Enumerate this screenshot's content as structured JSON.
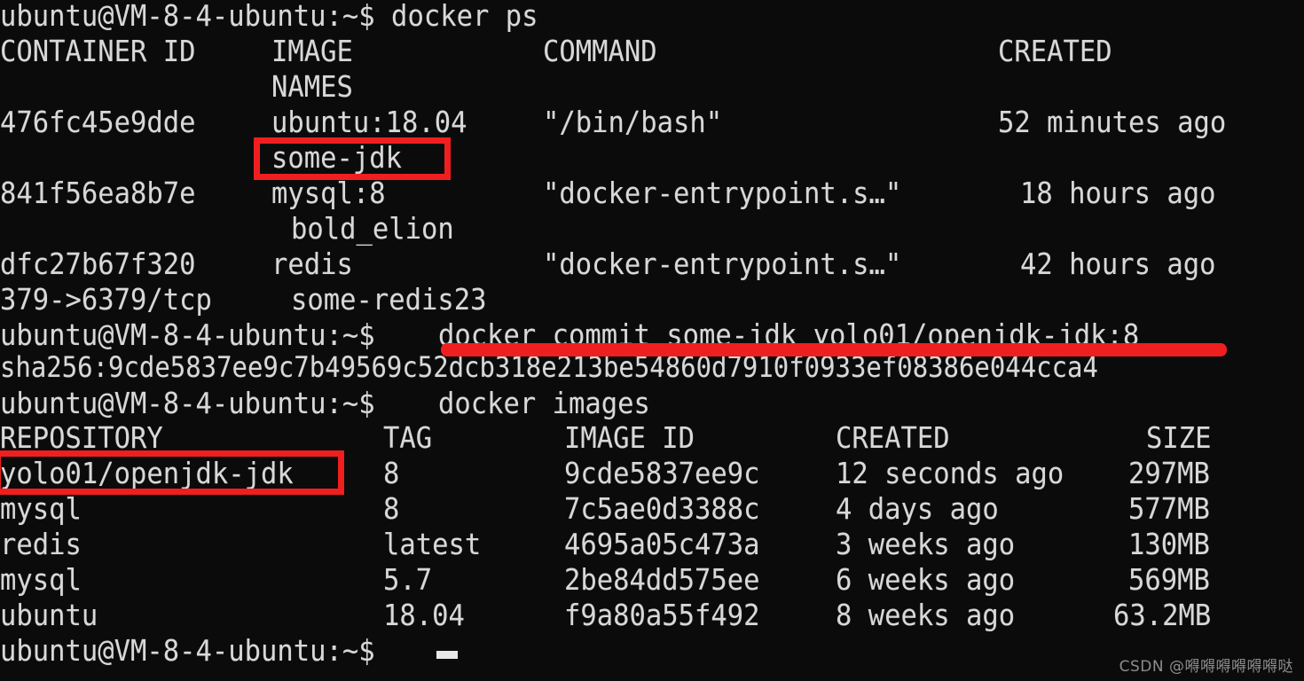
{
  "terminal": {
    "background_color": "#0b0b0b",
    "foreground_color": "#dcdcdc",
    "annotation_color": "#f01f1f",
    "prompt": "ubuntu@VM-8-4-ubuntu:~$",
    "lines": [
      "ubuntu@VM-8-4-ubuntu:~$ docker ps",
      "CONTAINER ID   IMAGE          COMMAND                  CREATED",
      "               NAMES",
      "476fc45e9dde   ubuntu:18.04   \"/bin/bash\"              52 minutes ago",
      "               some-jdk",
      "841f56ea8b7e   mysql:8        \"docker-entrypoint.s…\"   18 hours ago",
      "                bold_elion",
      "dfc27b67f320   redis          \"docker-entrypoint.s…\"   42 hours ago",
      "379->6379/tcp   some-redis23",
      "ubuntu@VM-8-4-ubuntu:~$ docker commit some-jdk yolo01/openjdk-jdk:8",
      "sha256:9cde5837ee9c7b49569c52dcb318e213be54860d7910f0933ef08386e044cca4",
      "ubuntu@VM-8-4-ubuntu:~$ docker images",
      "REPOSITORY           TAG      IMAGE ID       CREATED          SIZE",
      "yolo01/openjdk-jdk   8        9cde5837ee9c   12 seconds ago   297MB",
      "mysql                8        7c5ae0d3388c   4 days ago       577MB",
      "redis                latest   4695a05c473a   3 weeks ago      130MB",
      "mysql                5.7      2be84dd575ee   6 weeks ago      569MB",
      "ubuntu               18.04    f9a80a55f492   8 weeks ago      63.2MB",
      "ubuntu@VM-8-4-ubuntu:~$ "
    ]
  },
  "commands": {
    "docker_ps": "docker ps",
    "docker_commit": "docker commit some-jdk yolo01/openjdk-jdk:8",
    "docker_images": "docker images",
    "commit_digest": "sha256:9cde5837ee9c7b49569c52dcb318e213be54860d7910f0933ef08386e044cca4"
  },
  "ps_table": {
    "headers": [
      "CONTAINER ID",
      "IMAGE",
      "COMMAND",
      "CREATED",
      "NAMES"
    ],
    "rows": [
      {
        "container_id": "476fc45e9dde",
        "image": "ubuntu:18.04",
        "command": "\"/bin/bash\"",
        "created": "52 minutes ago",
        "ports": "",
        "names": "some-jdk"
      },
      {
        "container_id": "841f56ea8b7e",
        "image": "mysql:8",
        "command": "\"docker-entrypoint.s…\"",
        "created": "18 hours ago",
        "ports": "",
        "names": "bold_elion"
      },
      {
        "container_id": "dfc27b67f320",
        "image": "redis",
        "command": "\"docker-entrypoint.s…\"",
        "created": "42 hours ago",
        "ports": "379->6379/tcp",
        "names": "some-redis23"
      }
    ]
  },
  "images_table": {
    "headers": [
      "REPOSITORY",
      "TAG",
      "IMAGE ID",
      "CREATED",
      "SIZE"
    ],
    "rows": [
      {
        "repository": "yolo01/openjdk-jdk",
        "tag": "8",
        "image_id": "9cde5837ee9c",
        "created": "12 seconds ago",
        "size": "297MB"
      },
      {
        "repository": "mysql",
        "tag": "8",
        "image_id": "7c5ae0d3388c",
        "created": "4 days ago",
        "size": "577MB"
      },
      {
        "repository": "redis",
        "tag": "latest",
        "image_id": "4695a05c473a",
        "created": "3 weeks ago",
        "size": "130MB"
      },
      {
        "repository": "mysql",
        "tag": "5.7",
        "image_id": "2be84dd575ee",
        "created": "6 weeks ago",
        "size": "569MB"
      },
      {
        "repository": "ubuntu",
        "tag": "18.04",
        "image_id": "f9a80a55f492",
        "created": "8 weeks ago",
        "size": "63.2MB"
      }
    ]
  },
  "rendered_rows": {
    "r00": "ubuntu@VM-8-4-ubuntu:~$ docker ps",
    "r01_a": "CONTAINER ID",
    "r01_b": "IMAGE",
    "r01_c": "COMMAND",
    "r01_d": "CREATED",
    "r02_b": "NAMES",
    "r03_a": "476fc45e9dde",
    "r03_b": "ubuntu:18.04",
    "r03_c": "\"/bin/bash\"",
    "r03_d": "52 minutes ago",
    "r04_b": "some-jdk",
    "r05_a": "841f56ea8b7e",
    "r05_b": "mysql:8",
    "r05_c": "\"docker-entrypoint.s…\"",
    "r05_d": "18 hours ago",
    "r06_b": "bold_elion",
    "r07_a": "dfc27b67f320",
    "r07_b": "redis",
    "r07_c": "\"docker-entrypoint.s…\"",
    "r07_d": "42 hours ago",
    "r08_a": "379->6379/tcp",
    "r08_b": "some-redis23",
    "r09_prompt": "ubuntu@VM-8-4-ubuntu:~$",
    "r09_cmd": "docker commit some-jdk yolo01/openjdk-jdk:8",
    "r10": "sha256:9cde5837ee9c7b49569c52dcb318e213be54860d7910f0933ef08386e044cca4",
    "r11_prompt": "ubuntu@VM-8-4-ubuntu:~$",
    "r11_cmd": "docker images",
    "r12_a": "REPOSITORY",
    "r12_b": "TAG",
    "r12_c": "IMAGE ID",
    "r12_d": "CREATED",
    "r12_e": "SIZE",
    "r13_a": "yolo01/openjdk-jdk",
    "r13_b": "8",
    "r13_c": "9cde5837ee9c",
    "r13_d": "12 seconds ago",
    "r13_e": "297MB",
    "r14_a": "mysql",
    "r14_b": "8",
    "r14_c": "7c5ae0d3388c",
    "r14_d": "4 days ago",
    "r14_e": "577MB",
    "r15_a": "redis",
    "r15_b": "latest",
    "r15_c": "4695a05c473a",
    "r15_d": "3 weeks ago",
    "r15_e": "130MB",
    "r16_a": "mysql",
    "r16_b": "5.7",
    "r16_c": "2be84dd575ee",
    "r16_d": "6 weeks ago",
    "r16_e": "569MB",
    "r17_a": "ubuntu",
    "r17_b": "18.04",
    "r17_c": "f9a80a55f492",
    "r17_d": "8 weeks ago",
    "r17_e": "63.2MB",
    "r18_prompt": "ubuntu@VM-8-4-ubuntu:~$"
  },
  "annotations": {
    "box_some_jdk_label": "some-jdk",
    "box_repository_label": "yolo01/openjdk-jdk",
    "underline_commit_label": "docker commit some-jdk yolo01/openjdk-jdk:8",
    "color": "#f01f1f"
  },
  "watermark": {
    "text": "CSDN @嘚嘚嘚嘚嘚嘚哒"
  }
}
